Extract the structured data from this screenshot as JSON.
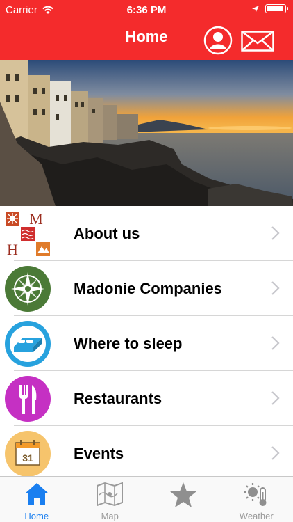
{
  "status_bar": {
    "carrier": "Carrier",
    "time": "6:36 PM"
  },
  "nav": {
    "title": "Home",
    "profile_icon": "profile-icon",
    "mail_icon": "mail-icon"
  },
  "colors": {
    "brand_red": "#f42b2c",
    "tab_active": "#1a7ff0",
    "tab_inactive": "#9a9a9a"
  },
  "menu": [
    {
      "label": "About us",
      "icon": "mhm-logo-icon"
    },
    {
      "label": "Madonie Companies",
      "icon": "compass-rose-icon"
    },
    {
      "label": "Where to sleep",
      "icon": "bed-icon"
    },
    {
      "label": "Restaurants",
      "icon": "fork-knife-icon"
    },
    {
      "label": "Events",
      "icon": "calendar-icon",
      "day": "31"
    }
  ],
  "tabs": [
    {
      "label": "Home",
      "icon": "home-icon",
      "active": true
    },
    {
      "label": "Map",
      "icon": "map-icon",
      "active": false
    },
    {
      "label": "",
      "icon": "star-icon",
      "active": false
    },
    {
      "label": "Weather",
      "icon": "weather-icon",
      "active": false
    }
  ]
}
